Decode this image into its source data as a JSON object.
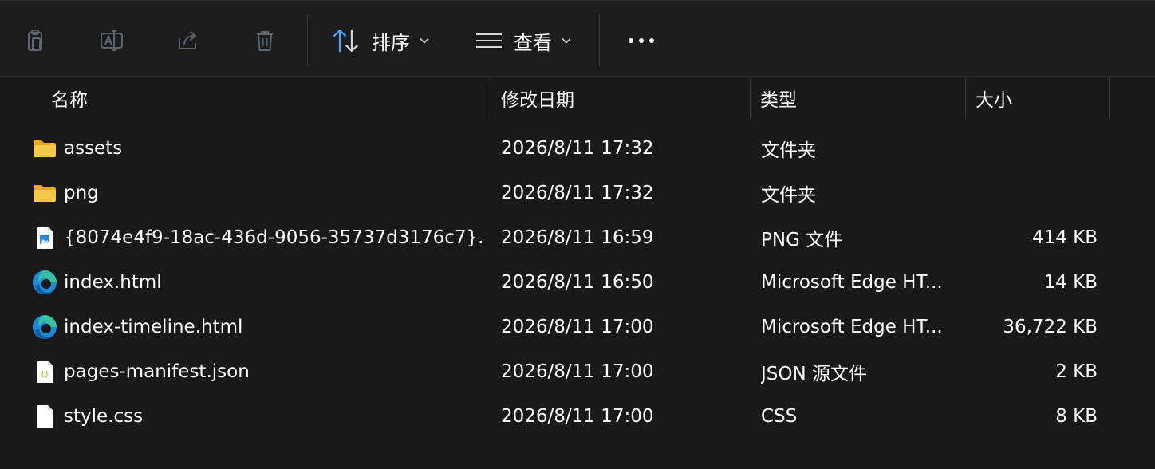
{
  "toolbar": {
    "sort_label": "排序",
    "view_label": "查看"
  },
  "columns": {
    "name": "名称",
    "date": "修改日期",
    "type": "类型",
    "size": "大小"
  },
  "files": [
    {
      "icon": "folder-icon",
      "name": "assets",
      "date": "2026/8/11 17:32",
      "type": "文件夹",
      "size": ""
    },
    {
      "icon": "folder-icon",
      "name": "png",
      "date": "2026/8/11 17:32",
      "type": "文件夹",
      "size": ""
    },
    {
      "icon": "image-file-icon",
      "name": "{8074e4f9-18ac-436d-9056-35737d3176c7}....",
      "date": "2026/8/11 16:59",
      "type": "PNG 文件",
      "size": "414 KB"
    },
    {
      "icon": "edge-icon",
      "name": "index.html",
      "date": "2026/8/11 16:50",
      "type": "Microsoft Edge HT...",
      "size": "14 KB"
    },
    {
      "icon": "edge-icon",
      "name": "index-timeline.html",
      "date": "2026/8/11 17:00",
      "type": "Microsoft Edge HT...",
      "size": "36,722 KB"
    },
    {
      "icon": "json-file-icon",
      "name": "pages-manifest.json",
      "date": "2026/8/11 17:00",
      "type": "JSON 源文件",
      "size": "2 KB"
    },
    {
      "icon": "css-file-icon",
      "name": "style.css",
      "date": "2026/8/11 17:00",
      "type": "CSS",
      "size": "8 KB"
    }
  ],
  "colors": {
    "background": "#191919",
    "disabled_icon": "#5a6a78",
    "accent": "#4aa3ff",
    "folder": "#f5c542"
  }
}
